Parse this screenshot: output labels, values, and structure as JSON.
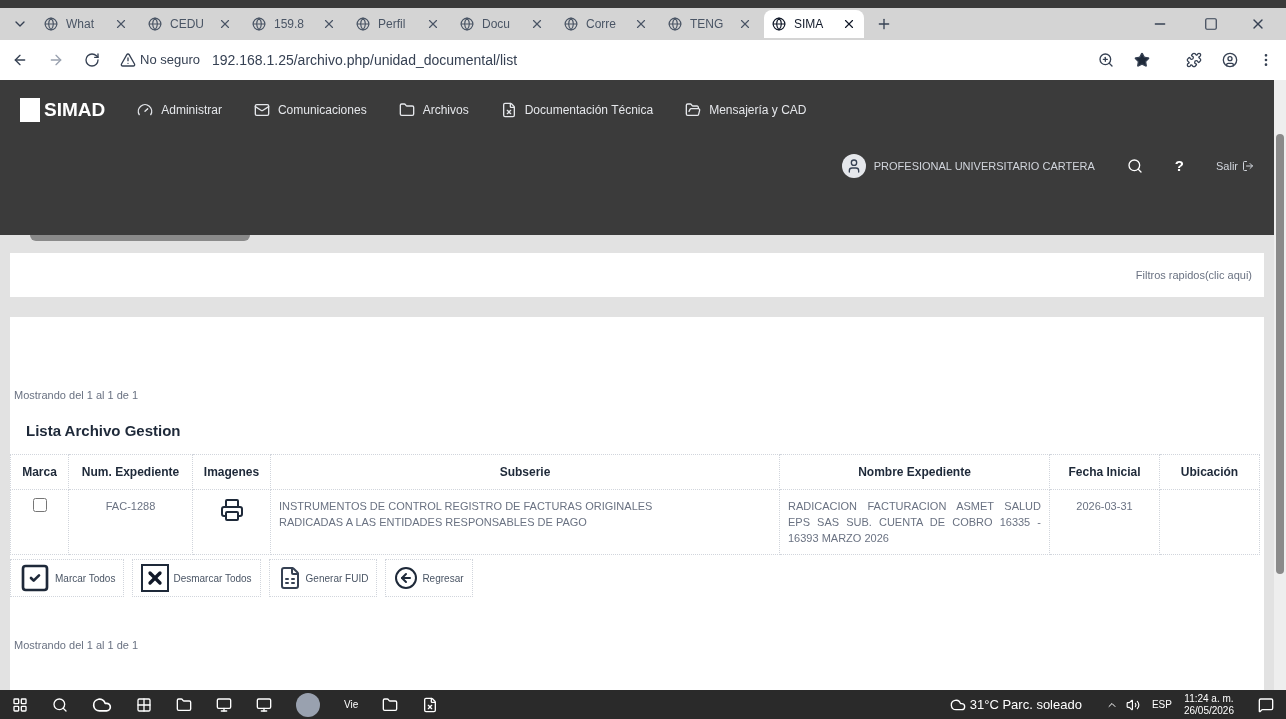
{
  "browser": {
    "tabs": [
      {
        "label": "What",
        "selected": false
      },
      {
        "label": "CEDU",
        "selected": false
      },
      {
        "label": "159.8",
        "selected": false
      },
      {
        "label": "Perfil",
        "selected": false
      },
      {
        "label": "Docu",
        "selected": false
      },
      {
        "label": "Corre",
        "selected": false
      },
      {
        "label": "TENG",
        "selected": false
      },
      {
        "label": "SIMA",
        "selected": true
      }
    ],
    "security": "No seguro",
    "url": "192.168.1.25/archivo.php/unidad_documental/list"
  },
  "app": {
    "logo": "SIMAD",
    "nav": [
      "Administrar",
      "Comunicaciones",
      "Archivos",
      "Documentación Técnica",
      "Mensajería y CAD"
    ],
    "user": "PROFESIONAL UNIVERSITARIO CARTERA",
    "help": "?",
    "logout": "Salir"
  },
  "filters": "Filtros rapidos(clic aqui)",
  "count_top": "Mostrando del 1 al 1 de 1",
  "list_title": "Lista Archivo Gestion",
  "table": {
    "columns": [
      "Marca",
      "Num. Expediente",
      "Imagenes",
      "Subserie",
      "Nombre Expediente",
      "Fecha Inicial",
      "Ubicación"
    ],
    "rows": [
      {
        "checked": false,
        "num": "FAC-1288",
        "subserie": "INSTRUMENTOS DE CONTROL REGISTRO DE FACTURAS ORIGINALES RADICADAS A LAS ENTIDADES RESPONSABLES DE PAGO",
        "nombre": "RADICACION FACTURACION ASMET SALUD EPS SAS SUB. CUENTA DE COBRO 16335 - 16393 MARZO 2026",
        "fecha": "2026-03-31"
      }
    ]
  },
  "actions": [
    {
      "kind": "check",
      "label": "Marcar Todos"
    },
    {
      "kind": "uncheck",
      "label": "Desmarcar Todos"
    },
    {
      "kind": "fuid",
      "label": "Generar FUID"
    },
    {
      "kind": "back",
      "label": "Regresar"
    }
  ],
  "count_bottom": "Mostrando del 1 al 1 de 1",
  "taskbar": {
    "app_label": "Vie",
    "weather": "31°C Parc. soleado",
    "lang": "ESP",
    "time": "11:24 a. m.",
    "date": "26/05/2026"
  }
}
